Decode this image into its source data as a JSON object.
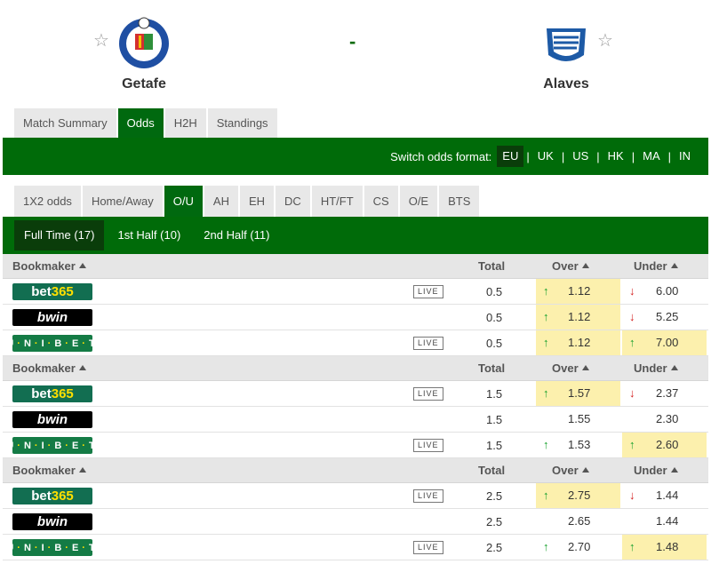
{
  "match": {
    "home": {
      "name": "Getafe"
    },
    "away": {
      "name": "Alaves"
    },
    "score_separator": "-"
  },
  "tabs_top": [
    {
      "label": "Match Summary",
      "active": false
    },
    {
      "label": "Odds",
      "active": true
    },
    {
      "label": "H2H",
      "active": false
    },
    {
      "label": "Standings",
      "active": false
    }
  ],
  "odds_format": {
    "label": "Switch odds format:",
    "options": [
      "EU",
      "UK",
      "US",
      "HK",
      "MA",
      "IN"
    ],
    "selected": "EU"
  },
  "odds_tabs": [
    {
      "label": "1X2 odds",
      "active": false
    },
    {
      "label": "Home/Away",
      "active": false
    },
    {
      "label": "O/U",
      "active": true
    },
    {
      "label": "AH",
      "active": false
    },
    {
      "label": "EH",
      "active": false
    },
    {
      "label": "DC",
      "active": false
    },
    {
      "label": "HT/FT",
      "active": false
    },
    {
      "label": "CS",
      "active": false
    },
    {
      "label": "O/E",
      "active": false
    },
    {
      "label": "BTS",
      "active": false
    }
  ],
  "half_tabs": [
    {
      "label": "Full Time (17)",
      "active": true
    },
    {
      "label": "1st Half (10)",
      "active": false
    },
    {
      "label": "2nd Half (11)",
      "active": false
    }
  ],
  "table_headers": {
    "bookmaker": "Bookmaker",
    "total": "Total",
    "over": "Over",
    "under": "Under"
  },
  "live_label": "LIVE",
  "groups": [
    {
      "rows": [
        {
          "bookmaker": "bet365",
          "live": true,
          "total": "0.5",
          "over": {
            "value": "1.12",
            "trend": "up",
            "highlight": true
          },
          "under": {
            "value": "6.00",
            "trend": "down",
            "highlight": false
          }
        },
        {
          "bookmaker": "bwin",
          "live": false,
          "total": "0.5",
          "over": {
            "value": "1.12",
            "trend": "up",
            "highlight": true
          },
          "under": {
            "value": "5.25",
            "trend": "down",
            "highlight": false
          }
        },
        {
          "bookmaker": "unibet",
          "live": true,
          "total": "0.5",
          "over": {
            "value": "1.12",
            "trend": "up",
            "highlight": true
          },
          "under": {
            "value": "7.00",
            "trend": "up",
            "highlight": true
          }
        }
      ]
    },
    {
      "rows": [
        {
          "bookmaker": "bet365",
          "live": true,
          "total": "1.5",
          "over": {
            "value": "1.57",
            "trend": "up",
            "highlight": true
          },
          "under": {
            "value": "2.37",
            "trend": "down",
            "highlight": false
          }
        },
        {
          "bookmaker": "bwin",
          "live": false,
          "total": "1.5",
          "over": {
            "value": "1.55",
            "trend": "",
            "highlight": false
          },
          "under": {
            "value": "2.30",
            "trend": "",
            "highlight": false
          }
        },
        {
          "bookmaker": "unibet",
          "live": true,
          "total": "1.5",
          "over": {
            "value": "1.53",
            "trend": "up",
            "highlight": false
          },
          "under": {
            "value": "2.60",
            "trend": "up",
            "highlight": true
          }
        }
      ]
    },
    {
      "rows": [
        {
          "bookmaker": "bet365",
          "live": true,
          "total": "2.5",
          "over": {
            "value": "2.75",
            "trend": "up",
            "highlight": true
          },
          "under": {
            "value": "1.44",
            "trend": "down",
            "highlight": false
          }
        },
        {
          "bookmaker": "bwin",
          "live": false,
          "total": "2.5",
          "over": {
            "value": "2.65",
            "trend": "",
            "highlight": false
          },
          "under": {
            "value": "1.44",
            "trend": "",
            "highlight": false
          }
        },
        {
          "bookmaker": "unibet",
          "live": true,
          "total": "2.5",
          "over": {
            "value": "2.70",
            "trend": "up",
            "highlight": false
          },
          "under": {
            "value": "1.48",
            "trend": "up",
            "highlight": true
          }
        }
      ]
    }
  ],
  "colors": {
    "primary_green": "#006b09",
    "active_dark": "#0a3d0a",
    "highlight": "#fcf0ad",
    "up": "#17a12d",
    "down": "#d21b1b"
  }
}
